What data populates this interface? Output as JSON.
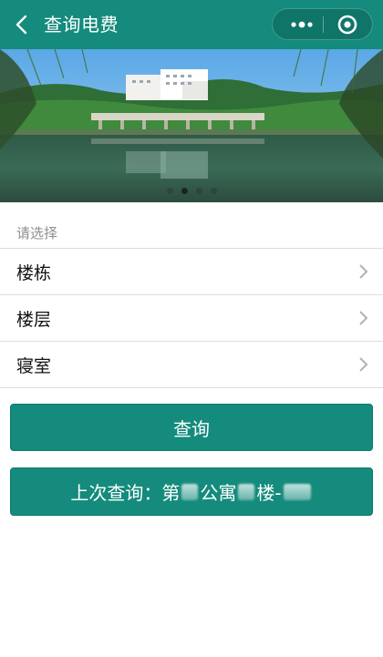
{
  "nav": {
    "title": "查询电费"
  },
  "banner": {
    "dot_count": 4,
    "active_dot": 2
  },
  "form": {
    "section_label": "请选择",
    "rows": [
      {
        "label": "楼栋"
      },
      {
        "label": "楼层"
      },
      {
        "label": "寝室"
      }
    ]
  },
  "buttons": {
    "query_label": "查询",
    "last_query_prefix": "上次查询：",
    "last_query_parts": [
      "第",
      "公寓",
      "楼-"
    ]
  },
  "colors": {
    "brand": "#148b7c",
    "brand_dark": "#0f7568"
  }
}
